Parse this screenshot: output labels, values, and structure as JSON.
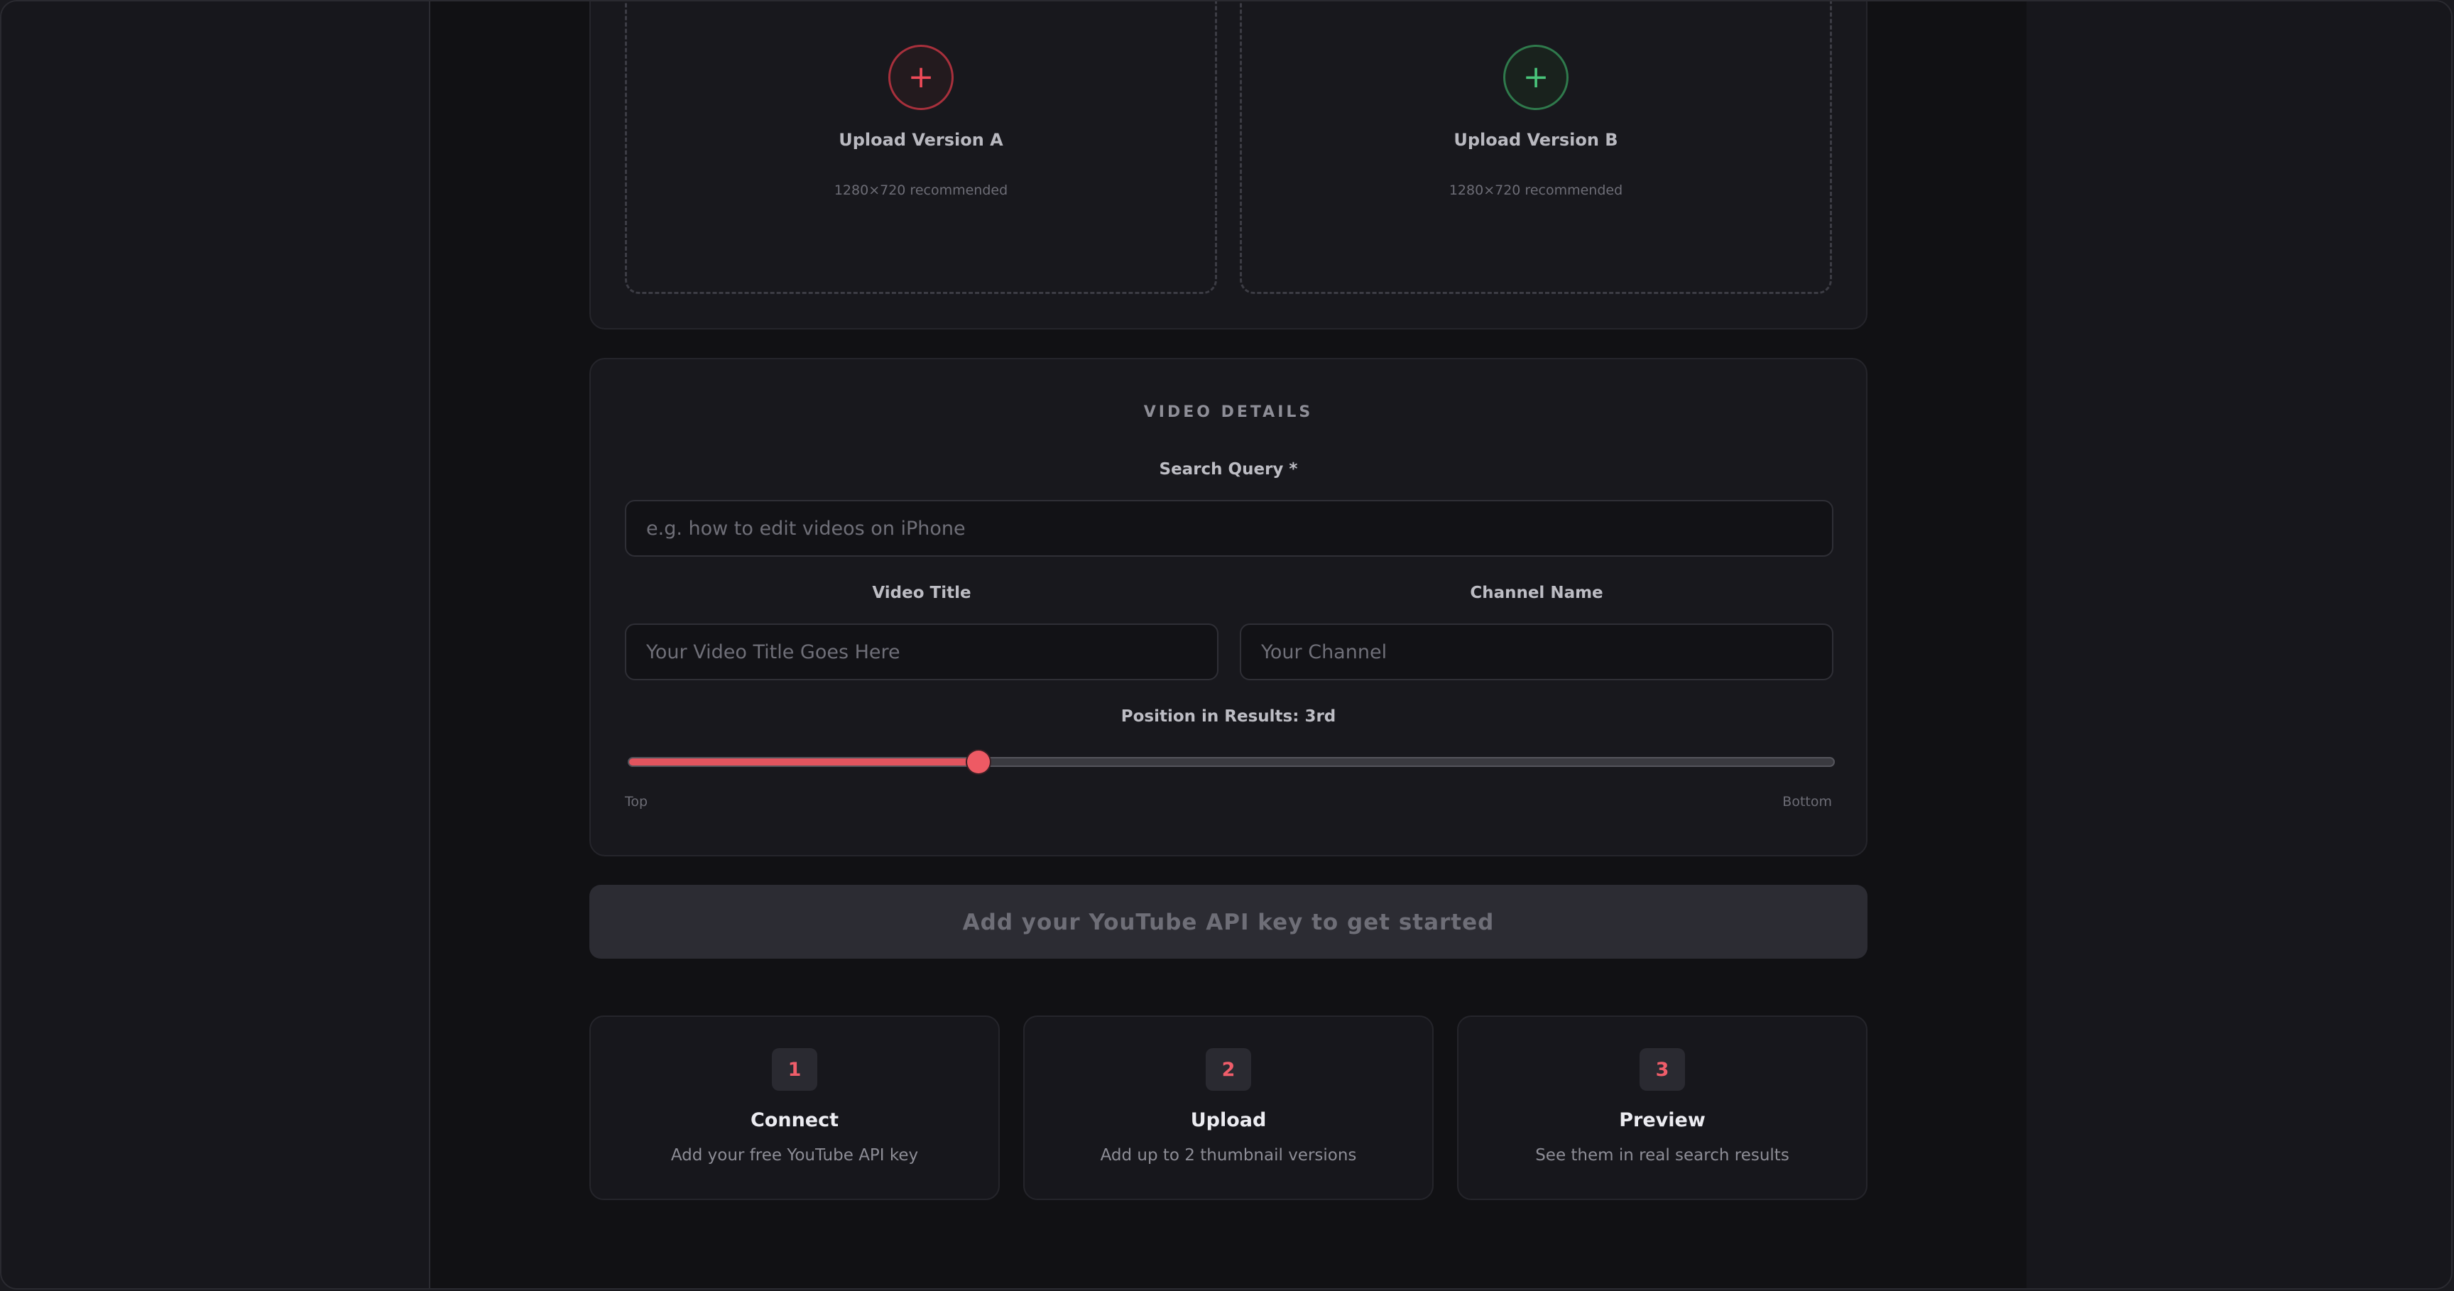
{
  "upload": {
    "version_a": {
      "title": "Upload Version A",
      "hint": "1280×720 recommended",
      "icon": "plus-icon",
      "accent": "#ef4a58"
    },
    "version_b": {
      "title": "Upload Version B",
      "hint": "1280×720 recommended",
      "icon": "plus-icon",
      "accent": "#49c47a"
    }
  },
  "details": {
    "section_title": "VIDEO DETAILS",
    "search_query": {
      "label": "Search Query *",
      "placeholder": "e.g. how to edit videos on iPhone",
      "value": ""
    },
    "video_title": {
      "label": "Video Title",
      "placeholder": "Your Video Title Goes Here",
      "value": ""
    },
    "channel_name": {
      "label": "Channel Name",
      "placeholder": "Your Channel",
      "value": ""
    },
    "position": {
      "label": "Position in Results: 3rd",
      "fraction": 0.29,
      "min_label": "Top",
      "max_label": "Bottom"
    }
  },
  "cta": {
    "label": "Add your YouTube API key to get started"
  },
  "steps": [
    {
      "number": "1",
      "title": "Connect",
      "description": "Add your free YouTube API key"
    },
    {
      "number": "2",
      "title": "Upload",
      "description": "Add up to 2 thumbnail versions"
    },
    {
      "number": "3",
      "title": "Preview",
      "description": "See them in real search results"
    }
  ],
  "colors": {
    "accent_red": "#e2545e",
    "accent_green": "#49c47a",
    "background": "#111114"
  }
}
